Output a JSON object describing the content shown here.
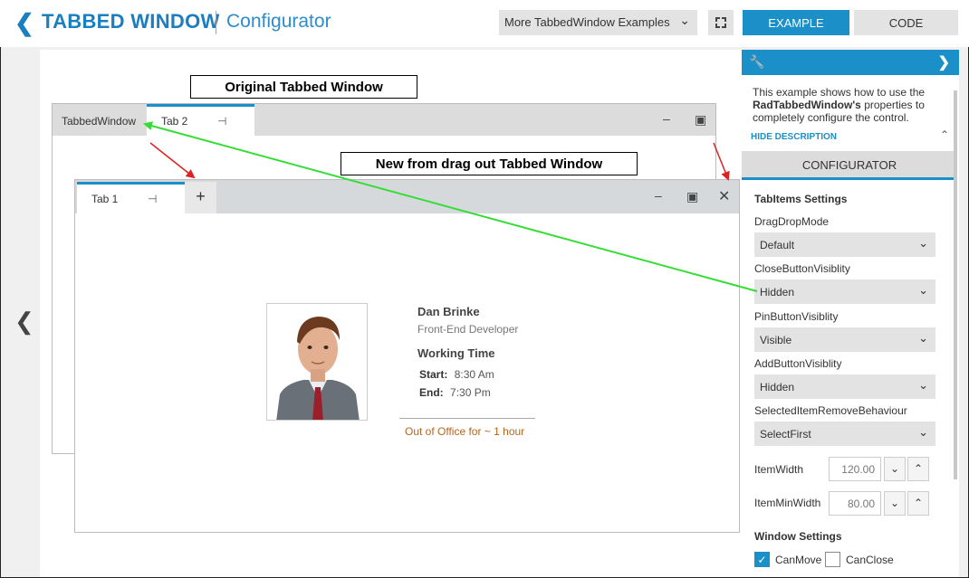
{
  "header": {
    "title": "TABBED WINDOW",
    "subtitle": "Configurator",
    "examples_dropdown": "More TabbedWindow Examples",
    "example_btn": "EXAMPLE",
    "code_btn": "CODE"
  },
  "callouts": {
    "original": "Original Tabbed Window",
    "new": "New from drag out Tabbed Window"
  },
  "original_window": {
    "title": "TabbedWindow",
    "tab2": "Tab 2"
  },
  "new_window": {
    "tab1": "Tab 1"
  },
  "employee": {
    "name": "Dan Brinke",
    "role": "Front-End Developer",
    "working_time_title": "Working Time",
    "start_label": "Start:",
    "start_value": "8:30 Am",
    "end_label": "End:",
    "end_value": "7:30 Pm",
    "status": "Out of Office for ~ 1 hour"
  },
  "panel": {
    "desc_pre": "This example shows how to use the ",
    "desc_bold": "RadTabbedWindow's",
    "desc_post": " properties to completely configure the control.",
    "hide_desc": "HIDE DESCRIPTION",
    "configurator": "CONFIGURATOR",
    "tabitems_title": "TabItems Settings",
    "fields": [
      {
        "label": "DragDropMode",
        "value": "Default"
      },
      {
        "label": "CloseButtonVisiblity",
        "value": "Hidden"
      },
      {
        "label": "PinButtonVisiblity",
        "value": "Visible"
      },
      {
        "label": "AddButtonVisiblity",
        "value": "Hidden"
      },
      {
        "label": "SelectedItemRemoveBehaviour",
        "value": "SelectFirst"
      }
    ],
    "item_width_label": "ItemWidth",
    "item_width_value": "120.00",
    "item_min_width_label": "ItemMinWidth",
    "item_min_width_value": "80.00",
    "window_title": "Window Settings",
    "can_move": "CanMove",
    "can_move_checked": true,
    "can_close": "CanClose",
    "can_close_checked": false
  },
  "colors": {
    "accent": "#1a8fc8",
    "arrow_green": "#33dd33",
    "arrow_red": "#dd2222"
  }
}
